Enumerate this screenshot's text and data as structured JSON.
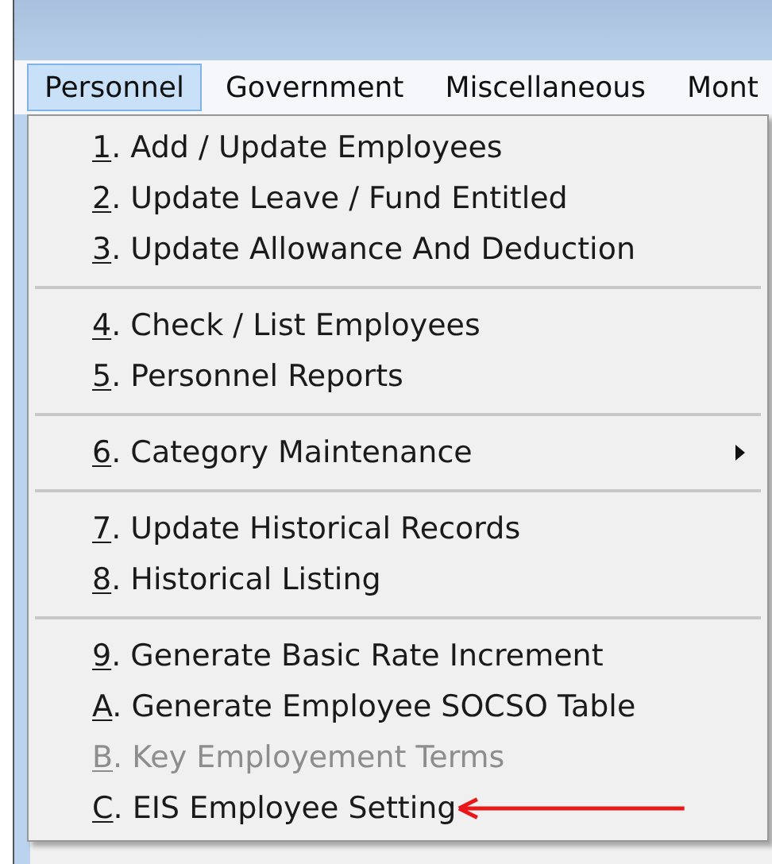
{
  "menu_bar": [
    {
      "label": "Personnel",
      "selected": true
    },
    {
      "label": "Government",
      "selected": false
    },
    {
      "label": "Miscellaneous",
      "selected": false
    },
    {
      "label": "Mont",
      "selected": false
    }
  ],
  "dropdown": {
    "groups": [
      {
        "items": [
          {
            "label": "1. Add / Update Employees",
            "disabled": false,
            "has_submenu": false,
            "annotated": false
          },
          {
            "label": "2. Update Leave / Fund Entitled",
            "disabled": false,
            "has_submenu": false,
            "annotated": false
          },
          {
            "label": "3. Update Allowance And Deduction",
            "disabled": false,
            "has_submenu": false,
            "annotated": false
          }
        ]
      },
      {
        "items": [
          {
            "label": "4. Check / List Employees",
            "disabled": false,
            "has_submenu": false,
            "annotated": false
          },
          {
            "label": "5. Personnel Reports",
            "disabled": false,
            "has_submenu": false,
            "annotated": false
          }
        ]
      },
      {
        "items": [
          {
            "label": "6. Category Maintenance",
            "disabled": false,
            "has_submenu": true,
            "annotated": false
          }
        ]
      },
      {
        "items": [
          {
            "label": "7. Update Historical Records",
            "disabled": false,
            "has_submenu": false,
            "annotated": false
          },
          {
            "label": "8. Historical Listing",
            "disabled": false,
            "has_submenu": false,
            "annotated": false
          }
        ]
      },
      {
        "items": [
          {
            "label": "9. Generate Basic Rate Increment",
            "disabled": false,
            "has_submenu": false,
            "annotated": false
          },
          {
            "label": "A. Generate Employee SOCSO Table",
            "disabled": false,
            "has_submenu": false,
            "annotated": false
          },
          {
            "label": "B. Key Employement Terms",
            "disabled": true,
            "has_submenu": false,
            "annotated": false
          },
          {
            "label": "C. EIS Employee Setting",
            "disabled": false,
            "has_submenu": false,
            "annotated": true
          }
        ]
      }
    ]
  }
}
